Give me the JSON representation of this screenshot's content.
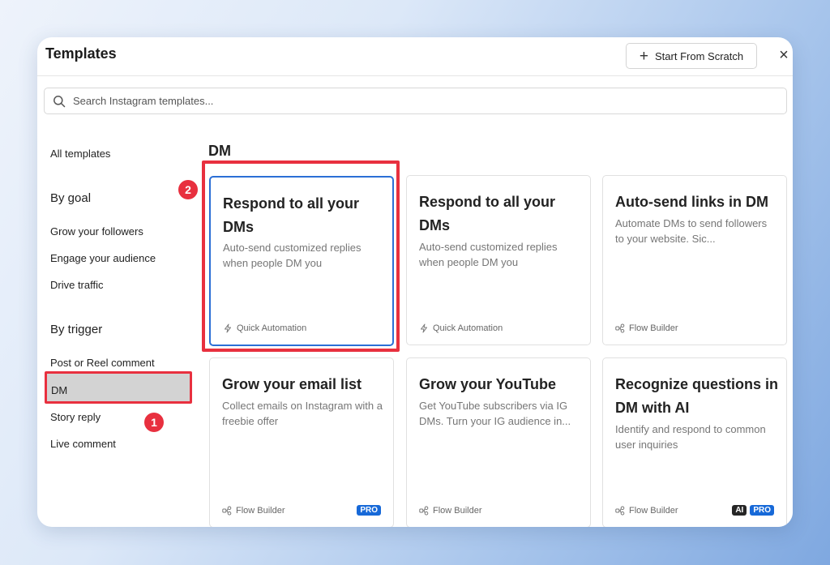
{
  "modal": {
    "title": "Templates",
    "start_from_scratch": "Start From Scratch",
    "close_glyph": "×"
  },
  "search": {
    "placeholder": "Search Instagram templates..."
  },
  "sidebar": {
    "all_templates": "All templates",
    "by_goal_heading": "By goal",
    "goal_items": [
      "Grow your followers",
      "Engage your audience",
      "Drive traffic"
    ],
    "by_trigger_heading": "By trigger",
    "trigger_items": [
      "Post or Reel comment",
      "DM",
      "Story reply",
      "Live comment"
    ],
    "selected": "DM"
  },
  "section": {
    "title": "DM"
  },
  "cards": [
    {
      "title": "Respond to all your DMs",
      "description": "Auto-send customized replies when people DM you",
      "footer": "Quick Automation",
      "footer_icon": "lightning-icon",
      "badges": []
    },
    {
      "title": "Respond to all your DMs",
      "description": "Auto-send customized replies when people DM you",
      "footer": "Quick Automation",
      "footer_icon": "lightning-icon",
      "badges": []
    },
    {
      "title": "Auto-send links in DM",
      "description": "Automate DMs to send followers to your website. Sic...",
      "footer": "Flow Builder",
      "footer_icon": "flow-icon",
      "badges": []
    },
    {
      "title": "Grow your email list",
      "description": "Collect emails on Instagram with a freebie offer",
      "footer": "Flow Builder",
      "footer_icon": "flow-icon",
      "badges": [
        "PRO"
      ]
    },
    {
      "title": "Grow your YouTube",
      "description": "Get YouTube subscribers via IG DMs. Turn your IG audience in...",
      "footer": "Flow Builder",
      "footer_icon": "flow-icon",
      "badges": []
    },
    {
      "title": "Recognize questions in DM with AI",
      "description": "Identify and respond to common user inquiries",
      "footer": "Flow Builder",
      "footer_icon": "flow-icon",
      "badges": [
        "AI",
        "PRO"
      ]
    }
  ],
  "annotations": {
    "step_1": "1",
    "step_2": "2"
  },
  "colors": {
    "highlight": "#e8303f",
    "active_card_border": "#2b6fd6",
    "pro_badge": "#1769d8",
    "ai_badge": "#262626"
  }
}
